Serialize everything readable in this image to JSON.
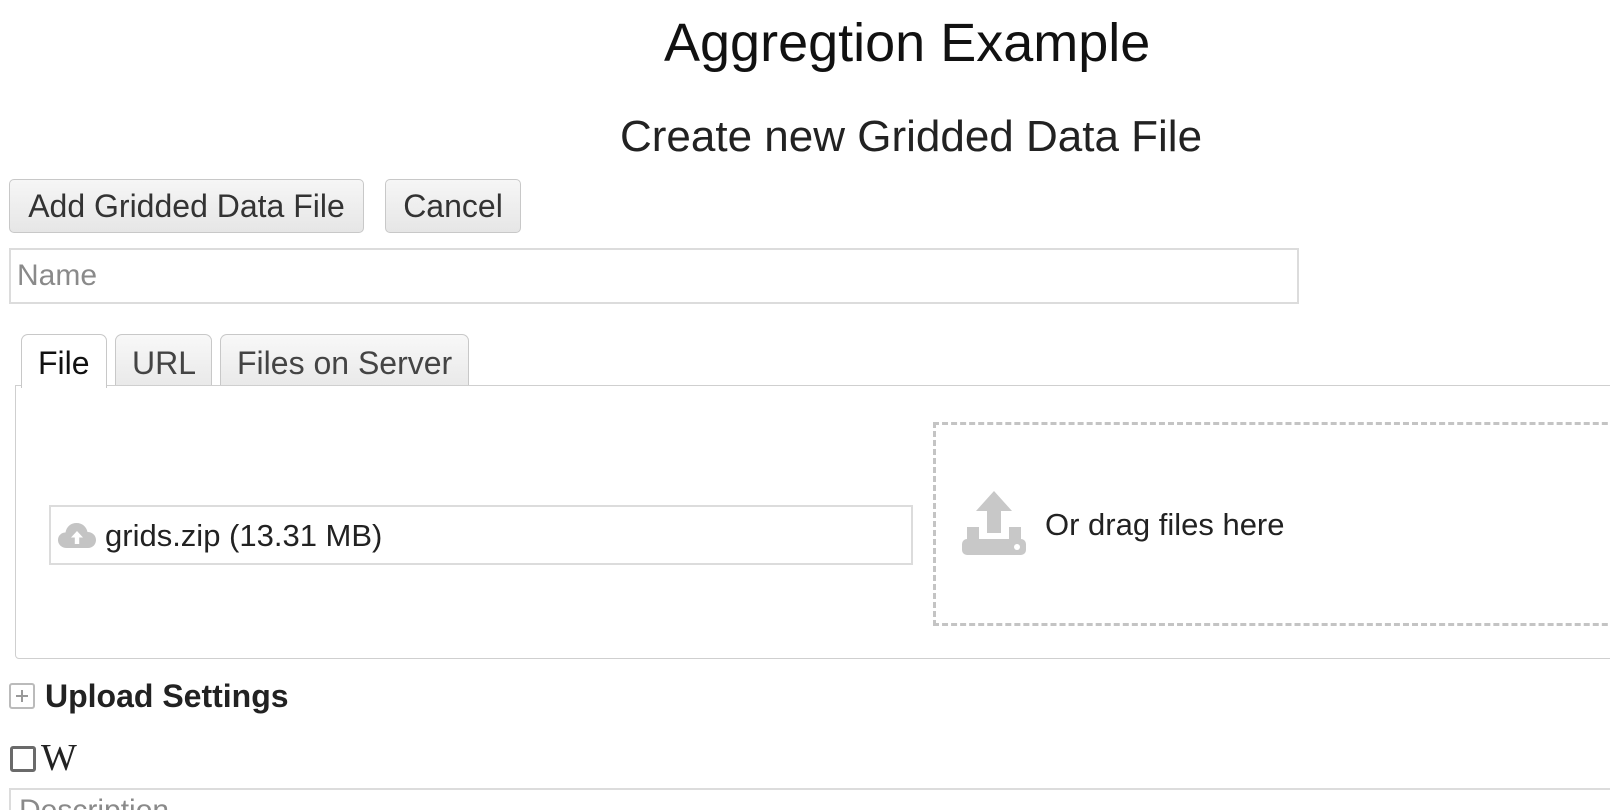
{
  "header": {
    "app_title": "Aggregtion Example",
    "form_title": "Create new Gridded Data File"
  },
  "toolbar": {
    "add_label": "Add Gridded Data File",
    "cancel_label": "Cancel"
  },
  "name_field": {
    "placeholder": "Name",
    "value": ""
  },
  "tabs": [
    {
      "label": "File",
      "active": true
    },
    {
      "label": "URL",
      "active": false
    },
    {
      "label": "Files on Server",
      "active": false
    }
  ],
  "file_panel": {
    "selected_file": "grids.zip (13.31 MB)",
    "file_icon": "cloud-upload-icon",
    "drop_text": "Or drag files here",
    "drop_icon": "upload-tray-icon"
  },
  "upload_settings": {
    "label": "Upload Settings",
    "icon": "plus-box-icon",
    "expanded": false
  },
  "w_option": {
    "label": "W",
    "checked": false
  },
  "description_field": {
    "placeholder": "Description",
    "value": ""
  },
  "colors": {
    "border": "#dcdcdc",
    "icon_gray": "#c8c8c8",
    "text": "#222222"
  }
}
